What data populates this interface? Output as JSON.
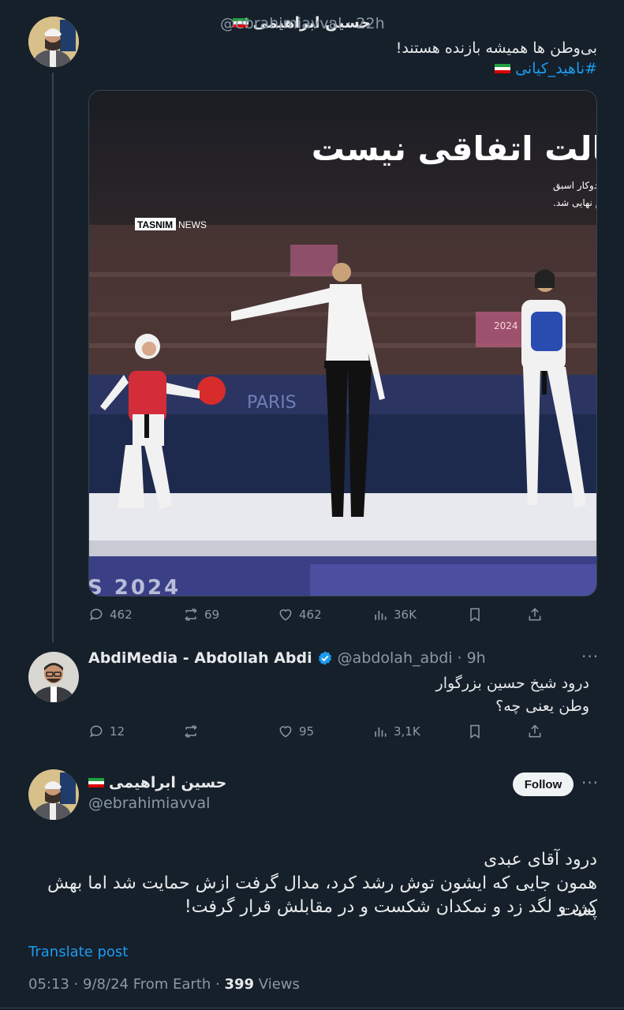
{
  "tweet1": {
    "author_name": "حسین ابراهیمی",
    "handle": "@ebrahimiavval",
    "time": "22h",
    "text": "بی‌وطن ها همیشه بازنده هستند!",
    "hashtag": "#ناهید_کیانی",
    "image": {
      "headline": "اصالت اتفاقی نیست",
      "caption_line1": "ناهید کیانی در مسابقات تکواندو المپیک ۲۰۲۴ پاریس مقابل کیمیا علیزاده، تکواندوکار اسبق",
      "caption_line2": "ایران که زیر پرچم بلغارستان رقابت میکند، به پیروزی رسید و راهی یک چهارم نهایی شد.",
      "brand_bold": "TASNIM",
      "brand_light": "NEWS",
      "bottom_text": "S 2024",
      "paris_text": "PARIS",
      "year_text": "2024"
    },
    "stats": {
      "replies": "462",
      "reposts": "69",
      "likes": "462",
      "views": "36K"
    }
  },
  "tweet2": {
    "author_name": "AbdiMedia - Abdollah Abdi",
    "handle": "@abdolah_abdi",
    "time": "9h",
    "line1": "درود شیخ حسین بزرگوار",
    "line2": "وطن یعنی چه؟",
    "stats": {
      "replies": "12",
      "reposts": "",
      "likes": "95",
      "views": "3,1K"
    }
  },
  "main": {
    "author_name": "حسین ابراهیمی",
    "handle": "@ebrahimiavval",
    "follow_label": "Follow",
    "line1": "درود آقای عبدی",
    "line2": "همون جایی که ایشون توش رشد کرد، مدال گرفت ازش حمایت شد اما بهش پشت",
    "line3": "کرد و لگد زد و نمکدان شکست و در مقابلش قرار گرفت!",
    "translate_label": "Translate post",
    "timestamp": "05:13 · 9/8/24 From Earth ·",
    "views_count": "399",
    "views_label": "Views"
  },
  "icons": [
    "reply-icon",
    "repost-icon",
    "like-icon",
    "views-icon",
    "bookmark-icon",
    "share-icon",
    "more-icon",
    "verified-icon",
    "iran-flag-icon"
  ],
  "colors": {
    "background": "#15202b",
    "accent": "#1d9bf0",
    "muted": "#8b98a5",
    "text": "#e7e9ea"
  }
}
